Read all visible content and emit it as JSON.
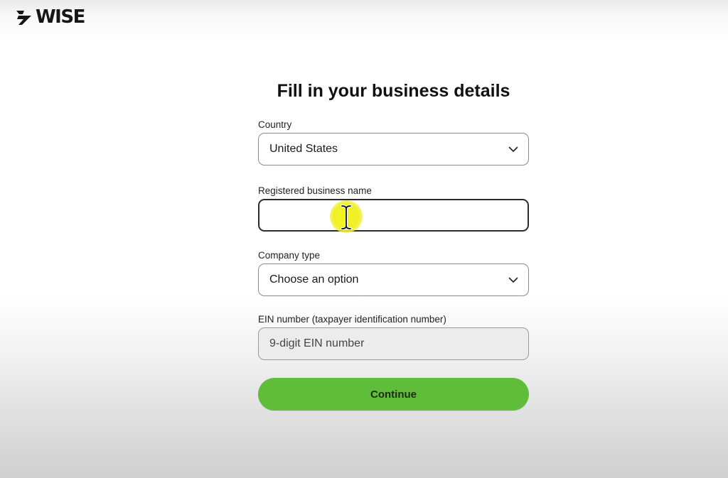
{
  "header": {
    "logo_text": "WISE",
    "logo_icon": "wise-flag-icon"
  },
  "form": {
    "title": "Fill in your business details",
    "country": {
      "label": "Country",
      "value": "United States",
      "icon": "chevron-down-icon"
    },
    "business_name": {
      "label": "Registered business name",
      "value": "",
      "focused": true
    },
    "company_type": {
      "label": "Company type",
      "value": "Choose an option",
      "icon": "chevron-down-icon"
    },
    "ein": {
      "label": "EIN number (taxpayer identification number)",
      "placeholder": "9-digit EIN number"
    },
    "continue_label": "Continue"
  },
  "colors": {
    "accent_green": "#5fbd3a",
    "cursor_highlight": "#f3f31a",
    "text_dark": "#111111"
  },
  "overlay": {
    "cursor_icon": "text-cursor-icon"
  }
}
